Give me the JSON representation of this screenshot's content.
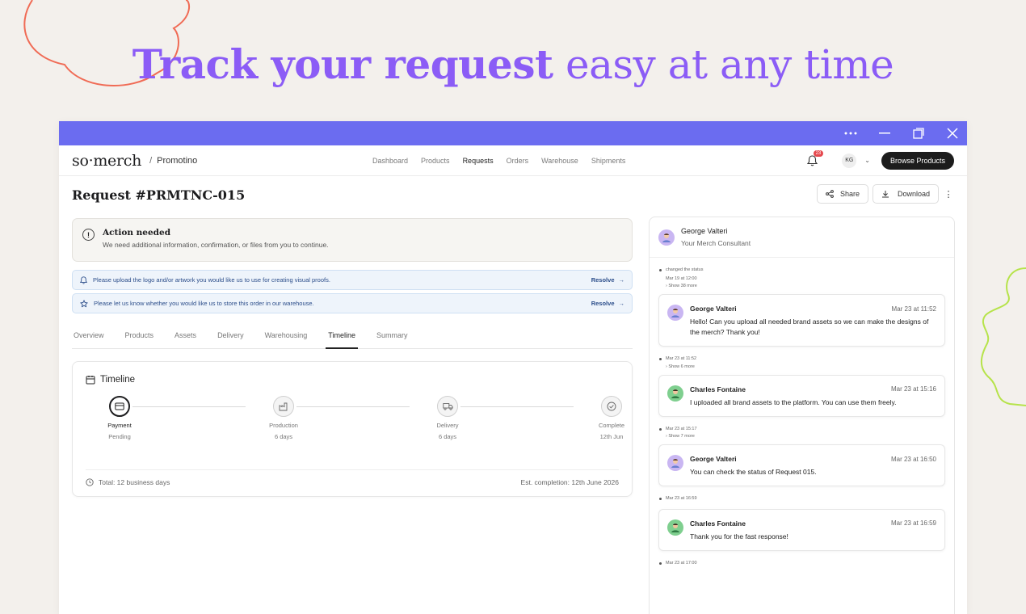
{
  "hero": {
    "bold": "Track your request",
    "light": "easy at any time"
  },
  "nav": {
    "logo": "so·merch",
    "separator": "/",
    "org": "Promotino",
    "links": [
      "Dashboard",
      "Products",
      "Requests",
      "Orders",
      "Warehouse",
      "Shipments"
    ],
    "active_link": "Requests",
    "notifications": "23",
    "user_initials": "KG",
    "browse_button": "Browse Products"
  },
  "request": {
    "title": "Request #PRMTNC-015",
    "share": "Share",
    "download": "Download"
  },
  "action": {
    "title": "Action needed",
    "desc": "We need additional information, confirmation, or files from you to continue."
  },
  "notices": [
    {
      "text": "Please upload the logo and/or artwork you would like us to use for creating visual proofs.",
      "action": "Resolve",
      "icon": "bell-icon"
    },
    {
      "text": "Please let us know whether you would like us to store this order in our warehouse.",
      "action": "Resolve",
      "icon": "star-icon"
    }
  ],
  "tabs": [
    "Overview",
    "Products",
    "Assets",
    "Delivery",
    "Warehousing",
    "Timeline",
    "Summary"
  ],
  "active_tab": "Timeline",
  "timeline": {
    "title": "Timeline",
    "steps": [
      {
        "label": "Payment",
        "sub": "Pending",
        "icon": "card-icon"
      },
      {
        "label": "Production",
        "sub": "6 days",
        "icon": "factory-icon"
      },
      {
        "label": "Delivery",
        "sub": "6 days",
        "icon": "truck-icon"
      },
      {
        "label": "Complete",
        "sub": "12th Jun",
        "icon": "check-circle-icon"
      }
    ],
    "total": "Total: 12 business days",
    "est": "Est. completion: 12th June 2026"
  },
  "consultant": {
    "name": "George Valteri",
    "role": "Your Merch Consultant"
  },
  "feed": {
    "status_event": "changed the status",
    "status_time": "Mar 19 at 12:00",
    "show_38": "Show 38 more",
    "msg1": {
      "name": "George Valteri",
      "time": "Mar 23 at 11:52",
      "text": "Hello! Can you upload all needed brand assets so we can make the designs of the merch? Thank you!"
    },
    "evt1": "Mar 23 at 11:52",
    "show_6": "Show 6 more",
    "msg2": {
      "name": "Charles Fontaine",
      "time": "Mar 23 at 15:16",
      "text": "I uploaded all brand assets to the platform. You can use them freely."
    },
    "evt2": "Mar 23 at 15:17",
    "show_7": "Show 7 more",
    "msg3": {
      "name": "George Valteri",
      "time": "Mar 23 at 16:50",
      "text": "You can check the status of Request 015."
    },
    "evt3": "Mar 23 at 16:59",
    "msg4": {
      "name": "Charles Fontaine",
      "time": "Mar 23 at 16:59",
      "text": "Thank you for the fast response!"
    },
    "evt4": "Mar 23 at 17:00"
  },
  "colors": {
    "hero": "#8b5cf6",
    "titlebar": "#6b6cf0",
    "deco_blob": "#f06b55",
    "deco_squiggle": "#b6e34a"
  }
}
